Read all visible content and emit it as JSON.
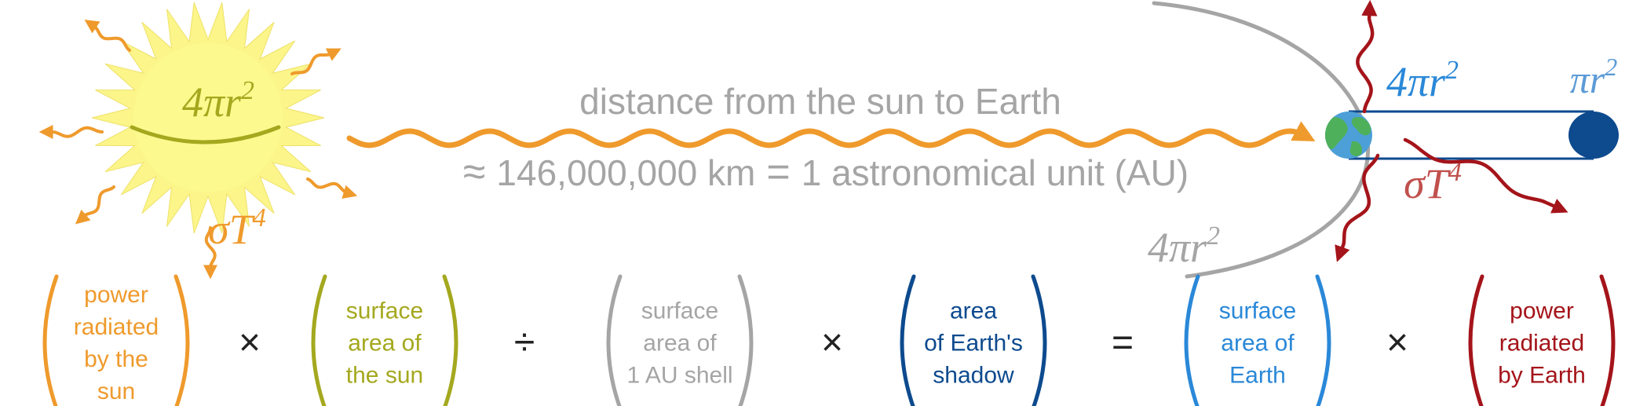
{
  "colors": {
    "sun_orange": "#EF9A2C",
    "sun_glow": "#FBF58A",
    "olive": "#A4A81E",
    "gray": "#A5A5A5",
    "light_blue": "#2A88D8",
    "dark_blue": "#0D4A8E",
    "dark_red": "#A4141A",
    "earth_blue": "#4D9FD8",
    "earth_green": "#4FB05B"
  },
  "sun": {
    "area_formula": "4πr",
    "area_exp": "2",
    "emission_formula": "σT",
    "emission_exp": "4"
  },
  "distance": {
    "title": "distance from the sun to Earth",
    "approx_sign": "≈",
    "value": "146,000,000 km",
    "equals": "=",
    "unit": "1 astronomical unit (AU)"
  },
  "shell": {
    "area_formula": "4πr",
    "area_exp": "2"
  },
  "earth": {
    "area_formula": "4πr",
    "area_exp": "2",
    "emission_formula": "σT",
    "emission_exp": "4",
    "shadow_formula": "πr",
    "shadow_exp": "2"
  },
  "equation": {
    "terms": [
      {
        "lines": [
          "power",
          "radiated",
          "by the",
          "sun"
        ]
      },
      {
        "lines": [
          "surface",
          "area of",
          "the sun"
        ]
      },
      {
        "lines": [
          "surface",
          "area of",
          "1 AU shell"
        ]
      },
      {
        "lines": [
          "area",
          "of Earth's",
          "shadow"
        ]
      },
      {
        "lines": [
          "surface",
          "area of",
          "Earth"
        ]
      },
      {
        "lines": [
          "power",
          "radiated",
          "by Earth"
        ]
      }
    ],
    "operators": [
      "×",
      "÷",
      "×",
      "=",
      "×"
    ]
  }
}
